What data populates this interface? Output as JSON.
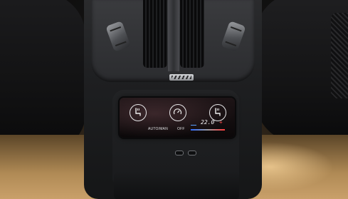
{
  "scene": {
    "subject": "rear-seat-climate-console",
    "colors": {
      "screen_bg": "#0b0809",
      "cold": "#2f6bff",
      "hot": "#ff3a3a",
      "floor_light": "#c9a06a"
    }
  },
  "climate_screen": {
    "controls": [
      {
        "name": "seat-heater",
        "icon": "heated-seat-icon",
        "caption": "AUTO/MAN"
      },
      {
        "name": "fan",
        "icon": "fan-dial-icon",
        "caption": "OFF"
      },
      {
        "name": "heated-seat-right",
        "icon": "heated-seat-icon"
      }
    ],
    "temperature": "22.0",
    "minus_symbol": "—",
    "plus_symbol": "+"
  },
  "ports": [
    {
      "icon": "usb-c-port-icon"
    },
    {
      "icon": "usb-c-port-icon"
    }
  ]
}
